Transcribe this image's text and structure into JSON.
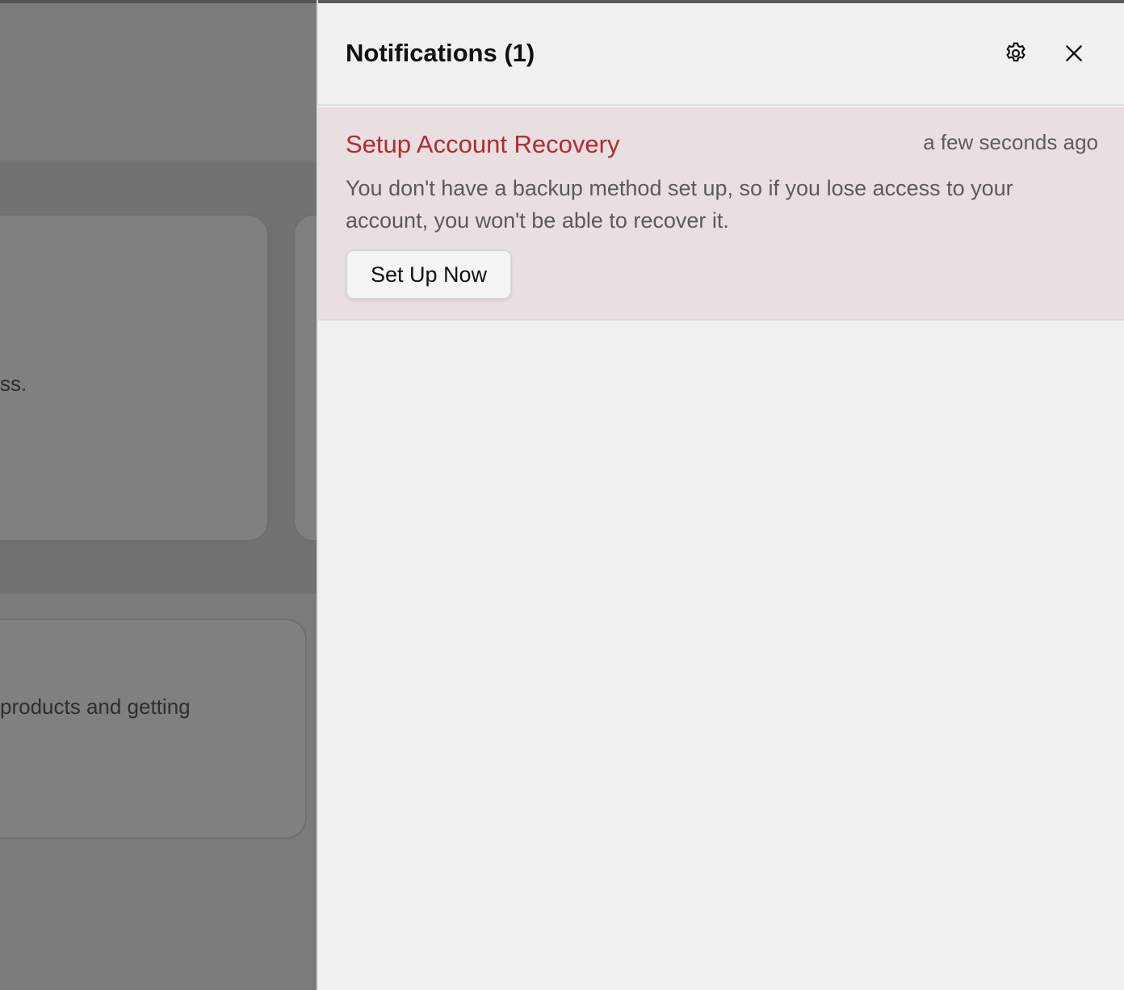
{
  "background": {
    "card_text_1": "ss.",
    "card_text_2": "products and getting"
  },
  "notifications_panel": {
    "title": "Notifications (1)",
    "settings_icon": "gear-icon",
    "close_icon": "close-icon",
    "items": [
      {
        "title": "Setup Account Recovery",
        "time": "a few seconds ago",
        "body": "You don't have a backup method set up, so if you lose access to your account, you won't be able to recover it.",
        "action_label": "Set Up Now",
        "title_color": "#b32a33",
        "background_color": "#eadfe0"
      }
    ]
  }
}
